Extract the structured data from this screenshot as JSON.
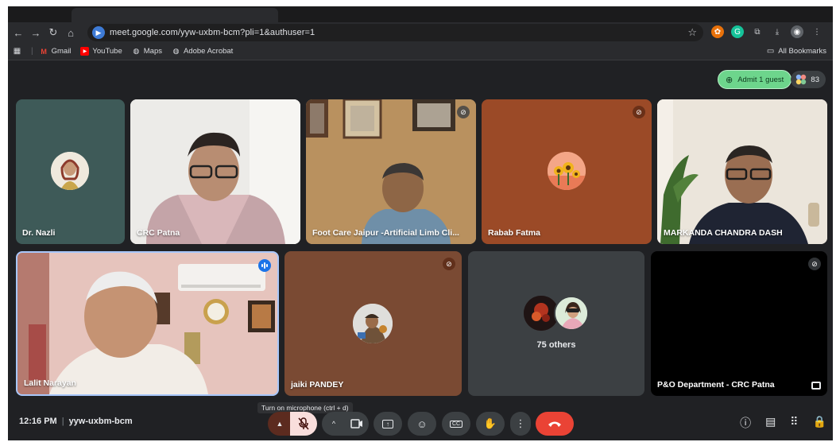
{
  "browser": {
    "url": "meet.google.com/yyw-uxbm-bcm?pli=1&authuser=1",
    "bookmarks": [
      "Gmail",
      "YouTube",
      "Maps",
      "Adobe Acrobat"
    ],
    "all_bookmarks": "All Bookmarks"
  },
  "meet": {
    "admit_label": "Admit 1 guest",
    "people_count": "83",
    "participants": [
      {
        "name": "Dr. Nazli",
        "muted": false
      },
      {
        "name": "CRC Patna",
        "muted": false
      },
      {
        "name": "Foot Care Jaipur -Artificial Limb Cli...",
        "muted": true
      },
      {
        "name": "Rabab Fatma",
        "muted": true
      },
      {
        "name": "MARKANDA CHANDRA DASH",
        "muted": false
      },
      {
        "name": "Lalit Narayan",
        "muted": false,
        "speaking": true
      },
      {
        "name": "jaiki PANDEY",
        "muted": true
      },
      {
        "name": "75 others",
        "muted": false
      },
      {
        "name": "P&O Department - CRC Patna",
        "muted": true
      }
    ],
    "time": "12:16 PM",
    "meeting_code": "yyw-uxbm-bcm",
    "tooltip": "Turn on microphone (ctrl + d)"
  },
  "colors": {
    "background": "#202124",
    "tile": "#3c4043",
    "hangup": "#ea4335",
    "admit": "#6dd58c",
    "mic_off_active": "#f9dedc"
  }
}
